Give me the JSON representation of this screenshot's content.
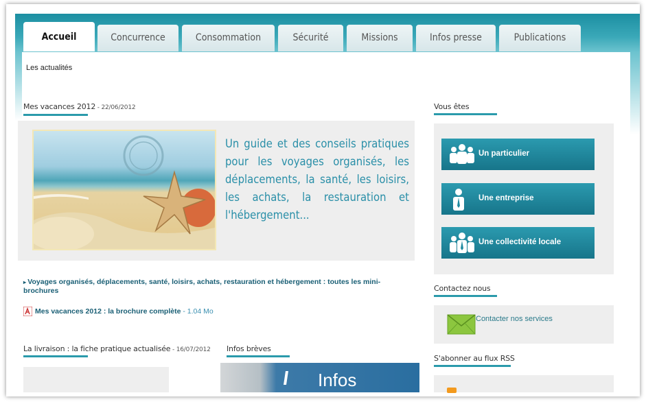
{
  "tabs": [
    "Accueil",
    "Concurrence",
    "Consommation",
    "Sécurité",
    "Missions",
    "Infos presse",
    "Publications"
  ],
  "subnav": "Les actualités",
  "featured": {
    "title": "Mes vacances 2012",
    "date": " - 22/06/2012",
    "text": "Un guide et des conseils pratiques pour les voyages organisés, les déplacements, la santé, les loisirs, les achats, la restauration et l'hébergement..."
  },
  "links": {
    "mini": "Voyages organisés, déplacements, santé, loisirs, achats, restauration et hébergement : toutes les mini-brochures",
    "brochure": "Mes vacances 2012 : la brochure complète",
    "brochure_size": " - 1.04 Mo"
  },
  "livraison": {
    "title": "La livraison : la fiche pratique actualisée",
    "date": " - 16/07/2012"
  },
  "infos_breves": {
    "title": "Infos brèves",
    "banner": "Infos"
  },
  "vous_etes": {
    "title": "Vous êtes",
    "buttons": [
      "Un particulier",
      "Une entreprise",
      "Une collectivité locale"
    ]
  },
  "contact": {
    "title": "Contactez nous",
    "link": "Contacter nos services"
  },
  "rss": {
    "title": "S'abonner au flux RSS"
  },
  "colors": {
    "accent": "#2a9aab",
    "button": "#1f8aa0",
    "text_link": "#1a5f75"
  },
  "icons": [
    "people-icon",
    "person-icon",
    "group-icon",
    "envelope-icon",
    "pdf-icon",
    "starfish-illustration",
    "rss-icon"
  ]
}
